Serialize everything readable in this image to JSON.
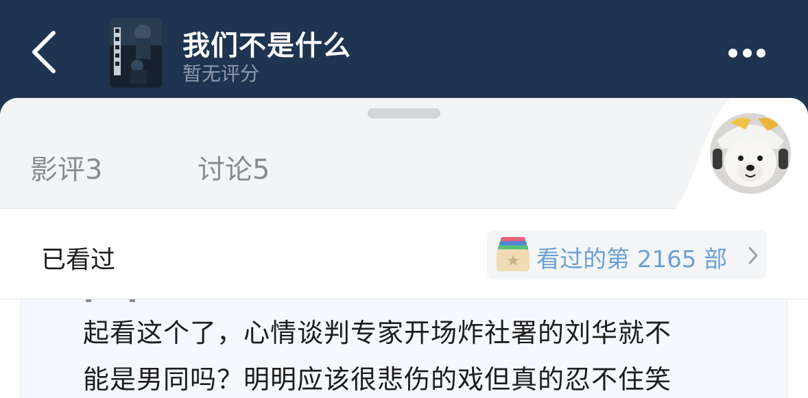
{
  "header": {
    "title": "我们不是什么",
    "rating": "暂无评分"
  },
  "tabs": [
    {
      "label": "影评",
      "count": "3"
    },
    {
      "label": "讨论",
      "count": "5"
    }
  ],
  "status": {
    "label": "已看过",
    "count_text": "看过的第 2165 部"
  },
  "review": {
    "lines": [
      "起看这个了，心情谈判专家开场炸社署的刘华就不",
      "能是男同吗？明明应该很悲伤的戏但真的忍不住笑"
    ]
  },
  "colors": {
    "header_bg": "#1f3450",
    "link_blue": "#6b9fd4",
    "tab_gray": "#888c90"
  },
  "icons": [
    "back-chevron-icon",
    "more-dots-icon",
    "watched-stack-icon",
    "chevron-right-icon"
  ]
}
